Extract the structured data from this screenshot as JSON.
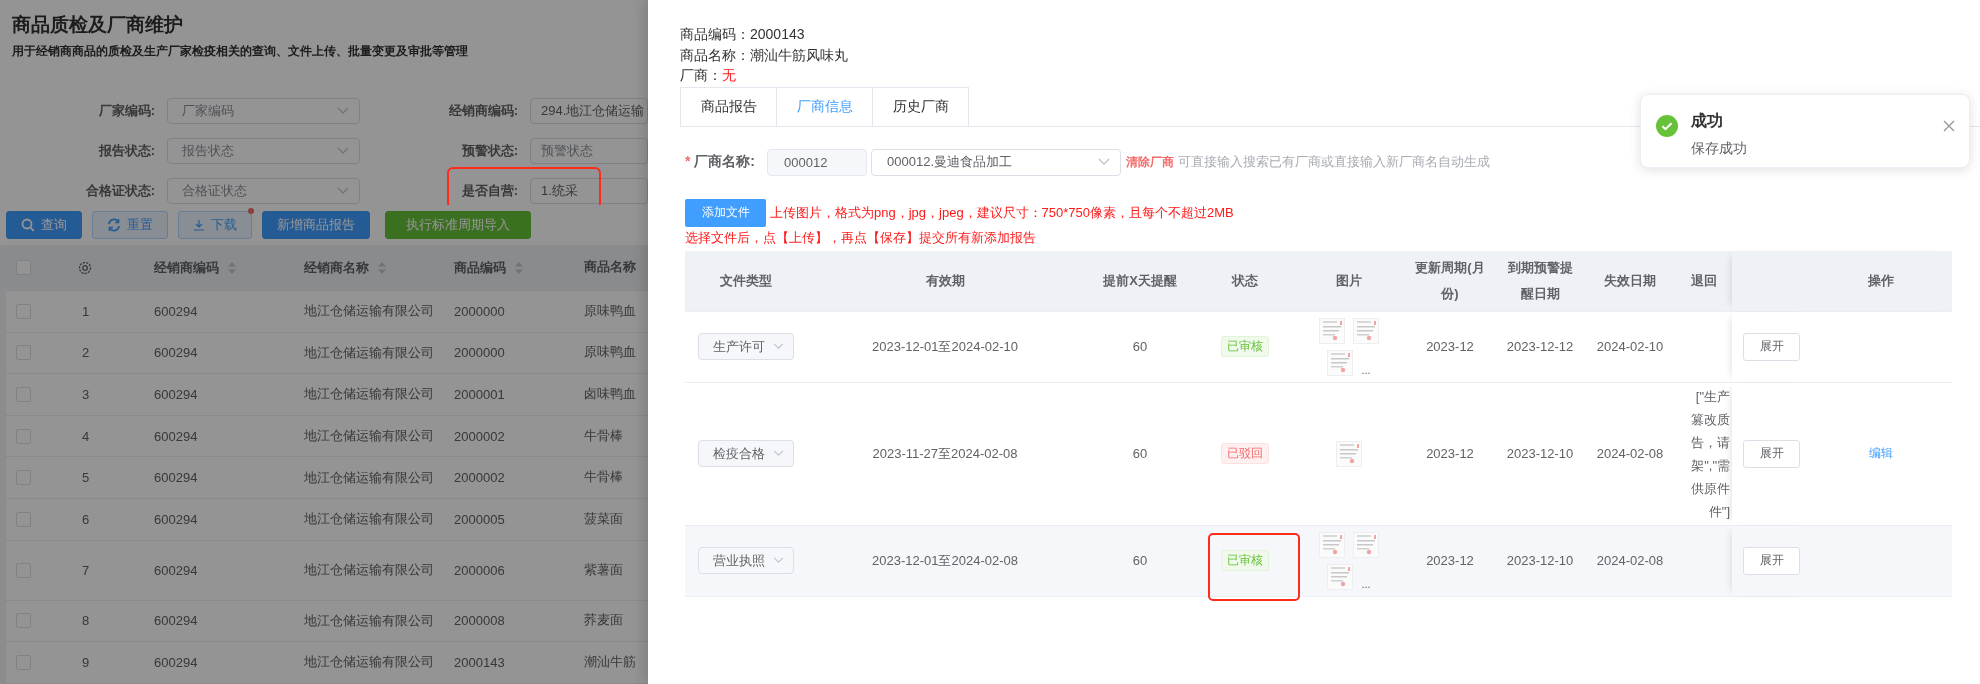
{
  "page": {
    "title": "商品质检及厂商维护",
    "subtitle": "用于经销商商品的质检及生产厂家检疫相关的查询、文件上传、批量变更及审批等管理"
  },
  "filters": [
    {
      "label": "厂家编码:",
      "placeholder": "厂家编码",
      "annotated": false
    },
    {
      "label": "经销商编码:",
      "value": "294.地江仓储运输",
      "annotated": false
    },
    {
      "label": "报告状态:",
      "placeholder": "报告状态",
      "annotated": false
    },
    {
      "label": "预警状态:",
      "placeholder": "预警状态",
      "annotated": false
    },
    {
      "label": "合格证状态:",
      "placeholder": "合格证状态",
      "annotated": false
    },
    {
      "label": "是否自营:",
      "value": "1.统采",
      "annotated": true
    }
  ],
  "toolbar": [
    {
      "label": "查询",
      "kind": "primary",
      "badge": false
    },
    {
      "label": "重置",
      "kind": "plain",
      "badge": false
    },
    {
      "label": "下载",
      "kind": "plain",
      "badge": true
    },
    {
      "label": "新增商品报告",
      "kind": "primary",
      "badge": false
    },
    {
      "label": "执行标准周期导入",
      "kind": "success",
      "badge": false
    }
  ],
  "table": {
    "all_checked": false,
    "columns": [
      {
        "label": "经销商编码",
        "sortable": true
      },
      {
        "label": "经销商名称",
        "sortable": true
      },
      {
        "label": "商品编码",
        "sortable": true
      },
      {
        "label": "商品名称"
      }
    ],
    "rows": [
      {
        "checked": false,
        "index": "1",
        "dealer_code": "600294",
        "dealer_name": "地江仓储运输有限公司",
        "product_code": "2000000",
        "product_name": "原味鸭血"
      },
      {
        "checked": false,
        "index": "2",
        "dealer_code": "600294",
        "dealer_name": "地江仓储运输有限公司",
        "product_code": "2000000",
        "product_name": "原味鸭血"
      },
      {
        "checked": false,
        "index": "3",
        "dealer_code": "600294",
        "dealer_name": "地江仓储运输有限公司",
        "product_code": "2000001",
        "product_name": "卤味鸭血"
      },
      {
        "checked": false,
        "index": "4",
        "dealer_code": "600294",
        "dealer_name": "地江仓储运输有限公司",
        "product_code": "2000002",
        "product_name": "牛骨棒"
      },
      {
        "checked": false,
        "index": "5",
        "dealer_code": "600294",
        "dealer_name": "地江仓储运输有限公司",
        "product_code": "2000002",
        "product_name": "牛骨棒"
      },
      {
        "checked": false,
        "index": "6",
        "dealer_code": "600294",
        "dealer_name": "地江仓储运输有限公司",
        "product_code": "2000005",
        "product_name": "菠菜面"
      },
      {
        "checked": false,
        "index": "7",
        "dealer_code": "600294",
        "dealer_name": "地江仓储运输有限公司",
        "product_code": "2000006",
        "product_name": "紫薯面"
      },
      {
        "checked": false,
        "index": "8",
        "dealer_code": "600294",
        "dealer_name": "地江仓储运输有限公司",
        "product_code": "2000008",
        "product_name": "荞麦面"
      },
      {
        "checked": false,
        "index": "9",
        "dealer_code": "600294",
        "dealer_name": "地江仓储运输有限公司",
        "product_code": "2000143",
        "product_name": "潮汕牛筋"
      }
    ]
  },
  "drawer": {
    "info": [
      {
        "label": "商品编码：",
        "value": "2000143",
        "alert": false
      },
      {
        "label": "商品名称：",
        "value": "潮汕牛筋风味丸",
        "alert": false
      },
      {
        "label": "厂商：",
        "value": "无",
        "alert": true
      }
    ],
    "tabs": [
      {
        "label": "商品报告",
        "selected": false
      },
      {
        "label": "厂商信息",
        "selected": true
      },
      {
        "label": "历史厂商",
        "selected": false
      }
    ],
    "vendor": {
      "required_mark": "*",
      "label": "厂商名称:",
      "code": "000012",
      "value": "000012.曼迪食品加工",
      "clear": "清除厂商",
      "hint": "可直接输入搜索已有厂商或直接输入新厂商名自动生成"
    },
    "upload": {
      "button": "添加文件",
      "note": "上传图片，格式为png，jpg，jpeg，建议尺寸：750*750像素，且每个不超过2MB",
      "note2": "选择文件后，点【上传】，再点【保存】提交所有新添加报告"
    },
    "report_table": {
      "columns": [
        "文件类型",
        "有效期",
        "提前X天提醒",
        "状态",
        "图片",
        "更新周期(月份)",
        "到期预警提醒日期",
        "失效日期",
        "退回",
        "操作"
      ],
      "rows": [
        {
          "type": "生产许可",
          "validity": "2023-12-01至2024-02-10",
          "remind": "60",
          "status": {
            "text": "已审核",
            "kind": "approved"
          },
          "more": "...",
          "cycle": "2023-12",
          "warn_date": "2023-12-12",
          "expire_date": "2024-02-10",
          "expand": "展开",
          "hovered": false,
          "annotated": false
        },
        {
          "type": "检疫合格",
          "validity": "2023-11-27至2024-02-08",
          "remind": "60",
          "status": {
            "text": "已驳回",
            "kind": "rejected"
          },
          "cycle": "2023-12",
          "warn_date": "2023-12-10",
          "expire_date": "2024-02-08",
          "return_reason": [
            "[\"生产",
            "篡改质",
            "告，请",
            "架\",\"需",
            "供原件",
            "件\"]"
          ],
          "expand": "展开",
          "action": "编辑",
          "hovered": false,
          "annotated": false
        },
        {
          "type": "营业执照",
          "validity": "2023-12-01至2024-02-08",
          "remind": "60",
          "status": {
            "text": "已审核",
            "kind": "approved"
          },
          "more": "...",
          "cycle": "2023-12",
          "warn_date": "2023-12-10",
          "expire_date": "2024-02-08",
          "expand": "展开",
          "hovered": true,
          "annotated": true
        }
      ]
    }
  },
  "toast": {
    "kind": "success",
    "title": "成功",
    "message": "保存成功"
  }
}
